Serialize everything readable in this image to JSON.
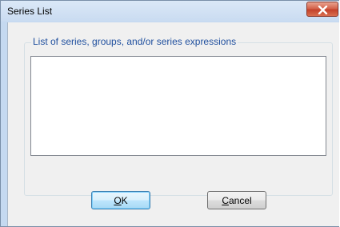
{
  "window": {
    "title": "Series List"
  },
  "group": {
    "label": "List of series, groups, and/or series expressions"
  },
  "listbox": {
    "items": []
  },
  "buttons": {
    "ok": {
      "mnemonic": "O",
      "rest": "K"
    },
    "cancel": {
      "mnemonic": "C",
      "rest": "ancel"
    }
  },
  "icons": {
    "close": "close-icon"
  },
  "colors": {
    "titlebar": "#c9dbf1",
    "close_button": "#c4412a",
    "group_label": "#1f4f9e",
    "client_bg": "#f0f0f0"
  }
}
